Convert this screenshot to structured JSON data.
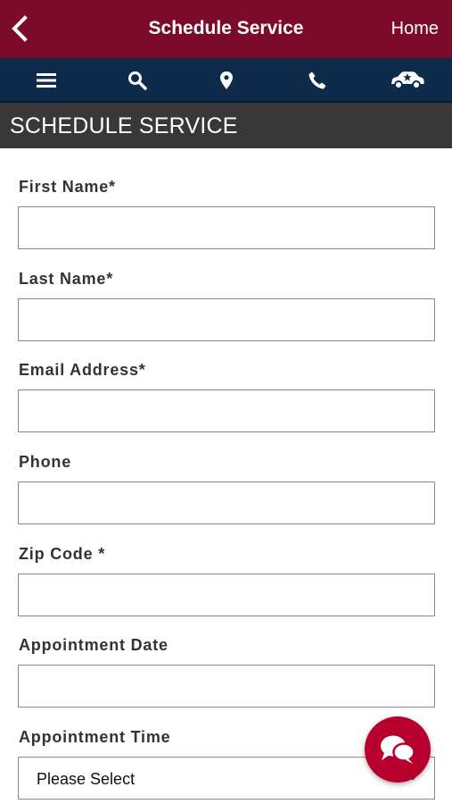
{
  "header": {
    "title": "Schedule Service",
    "home_label": "Home",
    "back_icon": "chevron-left-icon"
  },
  "nav": {
    "icons": [
      "menu-icon",
      "search-icon",
      "location-pin-icon",
      "phone-icon",
      "car-star-icon"
    ]
  },
  "section": {
    "title": "SCHEDULE SERVICE"
  },
  "form": {
    "first_name": {
      "label": "First Name*",
      "value": ""
    },
    "last_name": {
      "label": "Last Name*",
      "value": ""
    },
    "email": {
      "label": "Email Address*",
      "value": ""
    },
    "phone": {
      "label": "Phone",
      "value": ""
    },
    "zip": {
      "label": "Zip Code *",
      "value": ""
    },
    "appointment_date": {
      "label": "Appointment Date",
      "value": ""
    },
    "appointment_time": {
      "label": "Appointment Time",
      "selected": "Please Select"
    }
  },
  "colors": {
    "header_bg": "#7c0a2a",
    "nav_bg": "#0f2b4c",
    "section_bg": "#383838",
    "chat_button": "#b8002e"
  },
  "chat": {
    "icon": "chat-bubbles-icon"
  }
}
